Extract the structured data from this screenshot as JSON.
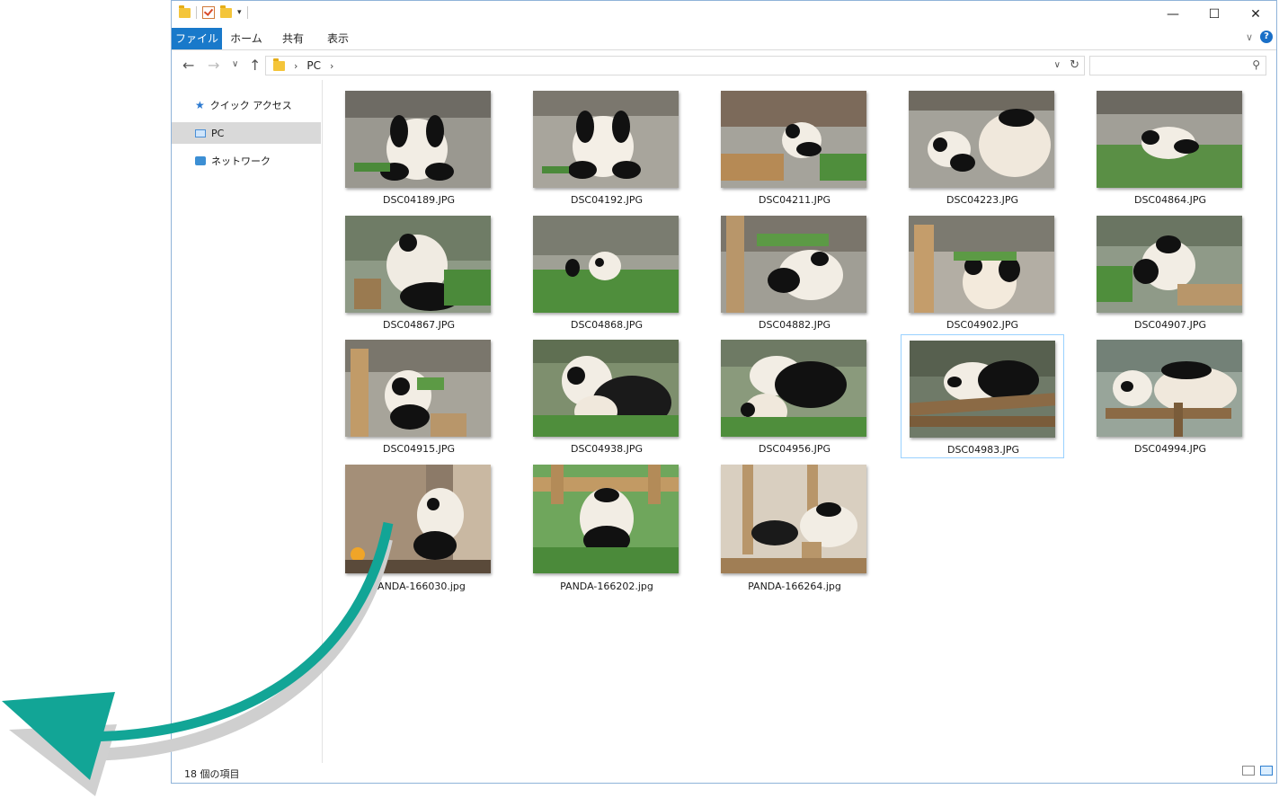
{
  "ribbon": {
    "tabs": [
      "ファイル",
      "ホーム",
      "共有",
      "表示"
    ]
  },
  "address": {
    "path": "PC"
  },
  "search": {
    "placeholder": ""
  },
  "nav": {
    "items": [
      "クイック アクセス",
      "PC",
      "ネットワーク"
    ]
  },
  "files": [
    "DSC04189.JPG",
    "DSC04192.JPG",
    "DSC04211.JPG",
    "DSC04223.JPG",
    "DSC04864.JPG",
    "DSC04867.JPG",
    "DSC04868.JPG",
    "DSC04882.JPG",
    "DSC04902.JPG",
    "DSC04907.JPG",
    "DSC04915.JPG",
    "DSC04938.JPG",
    "DSC04956.JPG",
    "DSC04983.JPG",
    "DSC04994.JPG",
    "PANDA-166030.jpg",
    "PANDA-166202.jpg",
    "PANDA-166264.jpg"
  ],
  "status": {
    "count_text": "18 個の項目"
  },
  "colors": {
    "accent": "#1979ca",
    "arrow": "#12a596",
    "selection": "#99d1ff"
  }
}
